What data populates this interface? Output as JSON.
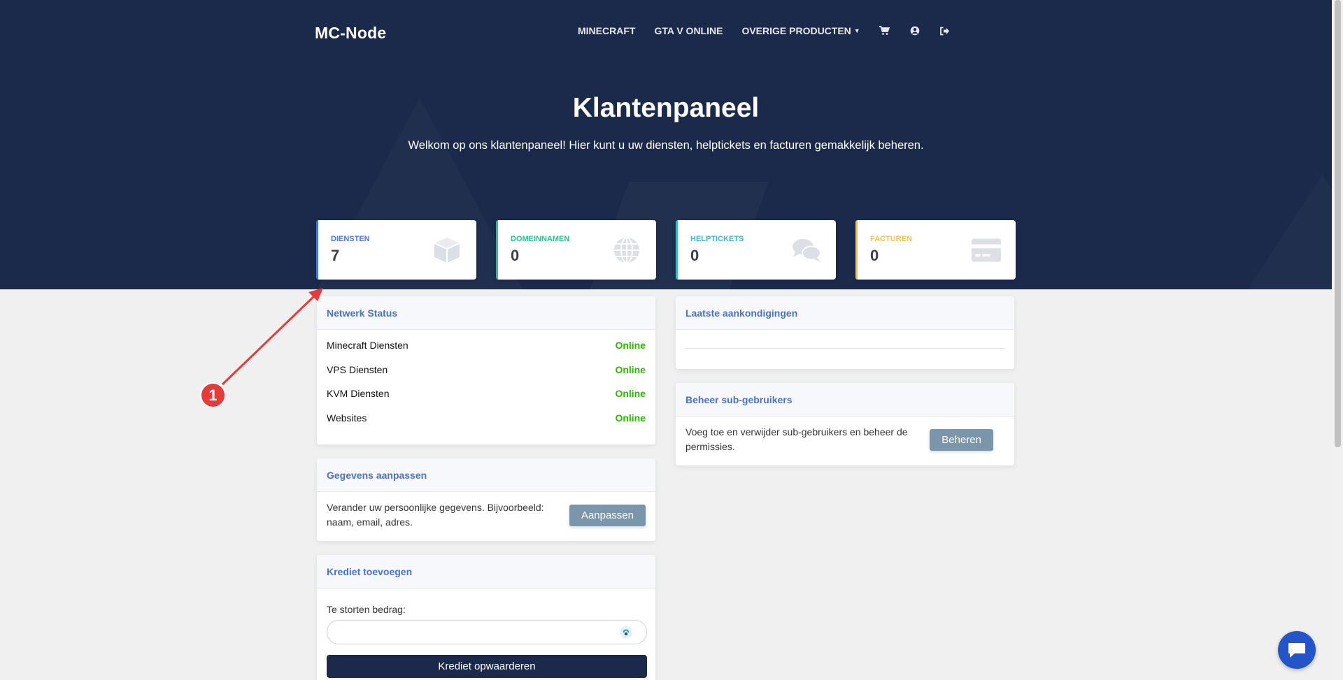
{
  "brand": "MC-Node",
  "nav": {
    "links": [
      "MINECRAFT",
      "GTA V ONLINE",
      "OVERIGE PRODUCTEN"
    ],
    "icons": [
      "cart-icon",
      "user-circle-icon",
      "logout-icon"
    ]
  },
  "hero": {
    "title": "Klantenpaneel",
    "subtitle": "Welkom op ons klantenpaneel! Hier kunt u uw diensten, helptickets en facturen gemakkelijk beheren."
  },
  "stats": [
    {
      "label": "DIENSTEN",
      "value": "7",
      "color": "#4a72e0",
      "icon": "cube-icon"
    },
    {
      "label": "DOMEINNAMEN",
      "value": "0",
      "color": "#1cc88a",
      "icon": "globe-icon"
    },
    {
      "label": "HELPTICKETS",
      "value": "0",
      "color": "#36b9cc",
      "icon": "comments-icon"
    },
    {
      "label": "FACTUREN",
      "value": "0",
      "color": "#f6c23e",
      "icon": "credit-card-icon"
    }
  ],
  "network": {
    "title": "Netwerk Status",
    "rows": [
      {
        "name": "Minecraft Diensten",
        "status": "Online"
      },
      {
        "name": "VPS Diensten",
        "status": "Online"
      },
      {
        "name": "KVM Diensten",
        "status": "Online"
      },
      {
        "name": "Websites",
        "status": "Online"
      }
    ]
  },
  "profile": {
    "title": "Gegevens aanpassen",
    "text": "Verander uw persoonlijke gegevens. Bijvoorbeeld: naam, email, adres.",
    "button": "Aanpassen"
  },
  "credit": {
    "title": "Krediet toevoegen",
    "label": "Te storten bedrag:",
    "value": "",
    "button": "Krediet opwaarderen"
  },
  "announcements": {
    "title": "Laatste aankondigingen"
  },
  "subusers": {
    "title": "Beheer sub-gebruikers",
    "text": "Voeg toe en verwijder sub-gebruikers en beheer de permissies.",
    "button": "Beheren"
  },
  "annotation": {
    "number": "1",
    "color": "#e63b3b"
  },
  "colors": {
    "navy": "#1b2a4a",
    "accent": "#4a72c4",
    "online": "#2ab800"
  }
}
